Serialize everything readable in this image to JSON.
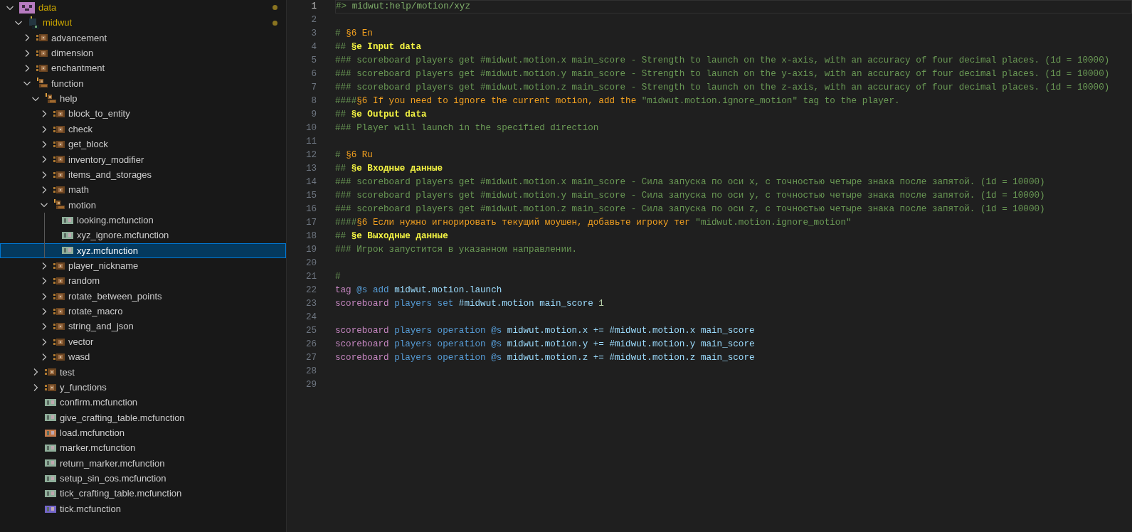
{
  "explorer": {
    "tree": [
      {
        "label": "data",
        "kind": "root",
        "expanded": true,
        "modified": true,
        "children": [
          {
            "label": "midwut",
            "kind": "namespace",
            "expanded": true,
            "modified": true,
            "children": [
              {
                "label": "advancement",
                "kind": "folder",
                "expanded": false
              },
              {
                "label": "dimension",
                "kind": "folder",
                "expanded": false
              },
              {
                "label": "enchantment",
                "kind": "folder",
                "expanded": false
              },
              {
                "label": "function",
                "kind": "folder",
                "expanded": true,
                "children": [
                  {
                    "label": "help",
                    "kind": "folder",
                    "expanded": true,
                    "children": [
                      {
                        "label": "block_to_entity",
                        "kind": "folder",
                        "expanded": false
                      },
                      {
                        "label": "check",
                        "kind": "folder",
                        "expanded": false
                      },
                      {
                        "label": "get_block",
                        "kind": "folder",
                        "expanded": false
                      },
                      {
                        "label": "inventory_modifier",
                        "kind": "folder",
                        "expanded": false
                      },
                      {
                        "label": "items_and_storages",
                        "kind": "folder",
                        "expanded": false
                      },
                      {
                        "label": "math",
                        "kind": "folder",
                        "expanded": false
                      },
                      {
                        "label": "motion",
                        "kind": "folder",
                        "expanded": true,
                        "children": [
                          {
                            "label": "looking.mcfunction",
                            "kind": "file",
                            "color": "#8fae9a",
                            "selected": false
                          },
                          {
                            "label": "xyz_ignore.mcfunction",
                            "kind": "file",
                            "color": "#8fae9a",
                            "selected": false
                          },
                          {
                            "label": "xyz.mcfunction",
                            "kind": "file",
                            "color": "#8fae9a",
                            "selected": true
                          }
                        ]
                      },
                      {
                        "label": "player_nickname",
                        "kind": "folder",
                        "expanded": false
                      },
                      {
                        "label": "random",
                        "kind": "folder",
                        "expanded": false
                      },
                      {
                        "label": "rotate_between_points",
                        "kind": "folder",
                        "expanded": false
                      },
                      {
                        "label": "rotate_macro",
                        "kind": "folder",
                        "expanded": false
                      },
                      {
                        "label": "string_and_json",
                        "kind": "folder",
                        "expanded": false
                      },
                      {
                        "label": "vector",
                        "kind": "folder",
                        "expanded": false
                      },
                      {
                        "label": "wasd",
                        "kind": "folder",
                        "expanded": false
                      }
                    ]
                  },
                  {
                    "label": "test",
                    "kind": "folder",
                    "expanded": false
                  },
                  {
                    "label": "y_functions",
                    "kind": "folder",
                    "expanded": false
                  },
                  {
                    "label": "confirm.mcfunction",
                    "kind": "file",
                    "color": "#8fae9a",
                    "selected": false
                  },
                  {
                    "label": "give_crafting_table.mcfunction",
                    "kind": "file",
                    "color": "#8fae9a",
                    "selected": false
                  },
                  {
                    "label": "load.mcfunction",
                    "kind": "file",
                    "color": "#c27a4c",
                    "selected": false
                  },
                  {
                    "label": "marker.mcfunction",
                    "kind": "file",
                    "color": "#8fae9a",
                    "selected": false
                  },
                  {
                    "label": "return_marker.mcfunction",
                    "kind": "file",
                    "color": "#8fae9a",
                    "selected": false
                  },
                  {
                    "label": "setup_sin_cos.mcfunction",
                    "kind": "file",
                    "color": "#8fae9a",
                    "selected": false
                  },
                  {
                    "label": "tick_crafting_table.mcfunction",
                    "kind": "file",
                    "color": "#8fae9a",
                    "selected": false
                  },
                  {
                    "label": "tick.mcfunction",
                    "kind": "file",
                    "color": "#7466c9",
                    "selected": false
                  }
                ]
              }
            ]
          }
        ]
      }
    ]
  },
  "editor": {
    "lines": [
      {
        "number": "1",
        "current": true,
        "tokens": [
          {
            "kind": "comment",
            "text": "#> "
          },
          {
            "kind": "path",
            "text": "midwut:help/motion/xyz"
          }
        ]
      },
      {
        "number": "2",
        "current": false
      },
      {
        "number": "3",
        "current": false,
        "tokens": [
          {
            "kind": "comment",
            "text": "# "
          },
          {
            "kind": "gold",
            "text": "§6 En"
          }
        ]
      },
      {
        "number": "4",
        "current": false,
        "tokens": [
          {
            "kind": "comment",
            "text": "## "
          },
          {
            "kind": "yellow",
            "text": "§e Input data"
          }
        ]
      },
      {
        "number": "5",
        "current": false,
        "tokens": [
          {
            "kind": "comment",
            "text": "### scoreboard players get #midwut.motion.x main_score - Strength to launch on the x-axis, with an accuracy of four decimal places. (1d = 10000)"
          }
        ]
      },
      {
        "number": "6",
        "current": false,
        "tokens": [
          {
            "kind": "comment",
            "text": "### scoreboard players get #midwut.motion.y main_score - Strength to launch on the y-axis, with an accuracy of four decimal places. (1d = 10000)"
          }
        ]
      },
      {
        "number": "7",
        "current": false,
        "tokens": [
          {
            "kind": "comment",
            "text": "### scoreboard players get #midwut.motion.z main_score - Strength to launch on the z-axis, with an accuracy of four decimal places. (1d = 10000)"
          }
        ]
      },
      {
        "number": "8",
        "current": false,
        "tokens": [
          {
            "kind": "comment",
            "text": "####"
          },
          {
            "kind": "gold",
            "text": "§6 If you need to ignore the current motion, add the "
          },
          {
            "kind": "comment",
            "text": "\"midwut.motion.ignore_motion\" tag to the player."
          }
        ]
      },
      {
        "number": "9",
        "current": false,
        "tokens": [
          {
            "kind": "comment",
            "text": "## "
          },
          {
            "kind": "yellow",
            "text": "§e Output data"
          }
        ]
      },
      {
        "number": "10",
        "current": false,
        "tokens": [
          {
            "kind": "comment",
            "text": "### Player will launch in the specified direction"
          }
        ]
      },
      {
        "number": "11",
        "current": false
      },
      {
        "number": "12",
        "current": false,
        "tokens": [
          {
            "kind": "comment",
            "text": "# "
          },
          {
            "kind": "gold",
            "text": "§6 Ru"
          }
        ]
      },
      {
        "number": "13",
        "current": false,
        "tokens": [
          {
            "kind": "comment",
            "text": "## "
          },
          {
            "kind": "yellow",
            "text": "§e Входные данные"
          }
        ]
      },
      {
        "number": "14",
        "current": false,
        "tokens": [
          {
            "kind": "comment",
            "text": "### scoreboard players get #midwut.motion.x main_score - Сила запуска по оси x, с точностью четыре знака после запятой. (1d = 10000)"
          }
        ]
      },
      {
        "number": "15",
        "current": false,
        "tokens": [
          {
            "kind": "comment",
            "text": "### scoreboard players get #midwut.motion.y main_score - Сила запуска по оси y, с точностью четыре знака после запятой. (1d = 10000)"
          }
        ]
      },
      {
        "number": "16",
        "current": false,
        "tokens": [
          {
            "kind": "comment",
            "text": "### scoreboard players get #midwut.motion.z main_score - Сила запуска по оси z, с точностью четыре знака после запятой. (1d = 10000)"
          }
        ]
      },
      {
        "number": "17",
        "current": false,
        "tokens": [
          {
            "kind": "comment",
            "text": "####"
          },
          {
            "kind": "gold",
            "text": "§6 Если нужно игнорировать текущий моушен, добавьте игроку тег "
          },
          {
            "kind": "comment",
            "text": "\"midwut.motion.ignore_motion\""
          }
        ]
      },
      {
        "number": "18",
        "current": false,
        "tokens": [
          {
            "kind": "comment",
            "text": "## "
          },
          {
            "kind": "yellow",
            "text": "§e Выходные данные"
          }
        ]
      },
      {
        "number": "19",
        "current": false,
        "tokens": [
          {
            "kind": "comment",
            "text": "### Игрок запустится в указанном направлении."
          }
        ]
      },
      {
        "number": "20",
        "current": false
      },
      {
        "number": "21",
        "current": false,
        "tokens": [
          {
            "kind": "comment",
            "text": "#"
          }
        ]
      },
      {
        "number": "22",
        "current": false,
        "tokens": [
          {
            "kind": "command",
            "text": "tag "
          },
          {
            "kind": "keyword",
            "text": "@s add "
          },
          {
            "kind": "name",
            "text": "midwut.motion.launch"
          }
        ]
      },
      {
        "number": "23",
        "current": false,
        "tokens": [
          {
            "kind": "command",
            "text": "scoreboard "
          },
          {
            "kind": "keyword",
            "text": "players set "
          },
          {
            "kind": "name",
            "text": "#midwut.motion main_score "
          },
          {
            "kind": "number",
            "text": "1"
          }
        ]
      },
      {
        "number": "24",
        "current": false
      },
      {
        "number": "25",
        "current": false,
        "tokens": [
          {
            "kind": "command",
            "text": "scoreboard "
          },
          {
            "kind": "keyword",
            "text": "players operation @s "
          },
          {
            "kind": "name",
            "text": "midwut.motion.x += #midwut.motion.x main_score"
          }
        ]
      },
      {
        "number": "26",
        "current": false,
        "tokens": [
          {
            "kind": "command",
            "text": "scoreboard "
          },
          {
            "kind": "keyword",
            "text": "players operation @s "
          },
          {
            "kind": "name",
            "text": "midwut.motion.y += #midwut.motion.y main_score"
          }
        ]
      },
      {
        "number": "27",
        "current": false,
        "tokens": [
          {
            "kind": "command",
            "text": "scoreboard "
          },
          {
            "kind": "keyword",
            "text": "players operation @s "
          },
          {
            "kind": "name",
            "text": "midwut.motion.z += #midwut.motion.z main_score"
          }
        ]
      },
      {
        "number": "28",
        "current": false
      },
      {
        "number": "29",
        "current": false
      }
    ]
  }
}
